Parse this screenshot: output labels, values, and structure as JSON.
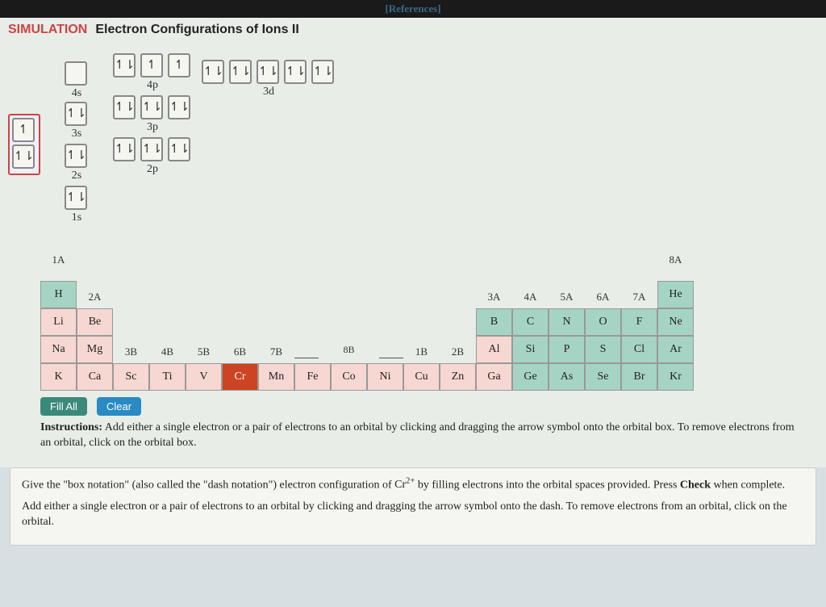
{
  "references_label": "[References]",
  "sim_label": "SIMULATION",
  "title": "Electron Configurations of Ions II",
  "dragsrc": {
    "single": "↿",
    "pair": "↿⇂"
  },
  "orbitals": {
    "s4": {
      "label": "4s",
      "boxes": [
        ""
      ]
    },
    "p4": {
      "label": "4p",
      "boxes": [
        "↿⇂",
        "↿",
        "↿"
      ]
    },
    "d3": {
      "label": "3d",
      "boxes": [
        "↿⇂",
        "↿⇂",
        "↿⇂",
        "↿⇂",
        "↿⇂"
      ]
    },
    "s3": {
      "label": "3s",
      "boxes": [
        "↿⇂"
      ]
    },
    "p3": {
      "label": "3p",
      "boxes": [
        "↿⇂",
        "↿⇂",
        "↿⇂"
      ]
    },
    "s2": {
      "label": "2s",
      "boxes": [
        "↿⇂"
      ]
    },
    "p2": {
      "label": "2p",
      "boxes": [
        "↿⇂",
        "↿⇂",
        "↿⇂"
      ]
    },
    "s1": {
      "label": "1s",
      "boxes": [
        "↿⇂"
      ]
    }
  },
  "groups_top": {
    "g1A": "1A",
    "g8A": "8A"
  },
  "groups_r2": {
    "g2A": "2A",
    "g3A": "3A",
    "g4A": "4A",
    "g5A": "5A",
    "g6A": "6A",
    "g7A": "7A"
  },
  "groups_tm": {
    "g3B": "3B",
    "g4B": "4B",
    "g5B": "5B",
    "g6B": "6B",
    "g7B": "7B",
    "g8B": "8B",
    "g1B": "1B",
    "g2B": "2B"
  },
  "elements": {
    "H": "H",
    "He": "He",
    "Li": "Li",
    "Be": "Be",
    "B": "B",
    "C": "C",
    "N": "N",
    "O": "O",
    "F": "F",
    "Ne": "Ne",
    "Na": "Na",
    "Mg": "Mg",
    "Al": "Al",
    "Si": "Si",
    "P": "P",
    "S": "S",
    "Cl": "Cl",
    "Ar": "Ar",
    "K": "K",
    "Ca": "Ca",
    "Sc": "Sc",
    "Ti": "Ti",
    "V": "V",
    "Cr": "Cr",
    "Mn": "Mn",
    "Fe": "Fe",
    "Co": "Co",
    "Ni": "Ni",
    "Cu": "Cu",
    "Zn": "Zn",
    "Ga": "Ga",
    "Ge": "Ge",
    "As": "As",
    "Se": "Se",
    "Br": "Br",
    "Kr": "Kr"
  },
  "buttons": {
    "fill": "Fill All",
    "clear": "Clear"
  },
  "instructions_label": "Instructions:",
  "instructions_text": " Add either a single electron or a pair of electrons to an orbital by clicking and dragging the arrow symbol onto the orbital box. To remove electrons from an orbital, click on the orbital box.",
  "question_p1a": "Give the \"box notation\" (also called the \"dash notation\") electron configuration of ",
  "question_ion": "Cr",
  "question_charge": "2+",
  "question_p1b": " by filling electrons into the orbital spaces provided. Press ",
  "question_check": "Check",
  "question_p1c": " when complete.",
  "question_p2": "Add either a single electron or a pair of electrons to an orbital by clicking and dragging the arrow symbol onto the dash. To remove electrons from an orbital, click on the orbital."
}
